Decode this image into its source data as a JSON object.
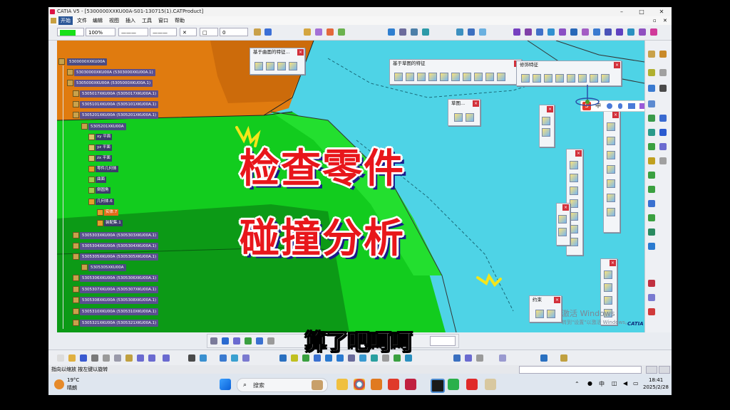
{
  "window": {
    "title": "CATIA V5 - [5300000XXKU00A-S01-130715(1).CATProduct]"
  },
  "menu": {
    "items": [
      "开始",
      "文件",
      "编辑",
      "视图",
      "插入",
      "工具",
      "窗口",
      "帮助"
    ]
  },
  "toolbar": {
    "zoom": "100%",
    "linewidth": "0"
  },
  "tree": {
    "root": "5300000XXKU00A",
    "nodes": [
      "53030000XKU00A (5303000XKU00A.1)",
      "5305000XKU00A (5305000XKU00A.1)",
      "5305017XKU00A (5305017XKU00A.1)",
      "5305101XKU00A (5305101XKU00A.1)",
      "5305201XKU00A (5305201XKU00A.1)"
    ],
    "part": "5305201XKU00A",
    "features": [
      "xy 平面",
      "yz 平面",
      "zx 平面",
      "零件几何体",
      "曲面",
      "倒圆角",
      "几何体.6",
      "实体.7",
      "装配集.1"
    ],
    "nodes2": [
      "5305303XKU00A (5305303XKU00A.1)",
      "5305304XKU00A (5305304XKU00A.1)",
      "5305305XKU00A (5305305XKU00A.1)",
      "5305305XKU00A",
      "5305306XKU00A (5305306XKU00A.1)",
      "5305307XKU00A (5305307XKU00A.1)",
      "5305308XKU00A (5305308XKU00A.1)",
      "5305310XKU00A (5305310XKU00A.1)",
      "5305321XKU00A (5305321XKU00A.1)"
    ]
  },
  "panels": {
    "surface": "基于曲面的特征...",
    "sketch": "基于草图的特征",
    "dress": "修饰特征",
    "sketcher": "草图...",
    "constraint": "约束"
  },
  "overlay": {
    "line1": "检查零件",
    "line2": "碰撞分析",
    "subtitle": "算了吧呵呵"
  },
  "status": {
    "hint": "指向以缩放  按左键以旋转"
  },
  "watermark": {
    "line1": "激活 Windows",
    "line2": "转到\"设置\"以激活 Windows。"
  },
  "brand": "CATIA",
  "taskbar": {
    "weather_temp": "19°C",
    "weather_desc": "晴朗",
    "search": "搜索",
    "time": "18:41",
    "date": "2025/2/28",
    "ime": "中"
  },
  "colors": {
    "viewport": "#4ed3e6",
    "overlay_red": "#e8161b",
    "green_part": "#12cc1e",
    "orange_part": "#e07b0f"
  }
}
